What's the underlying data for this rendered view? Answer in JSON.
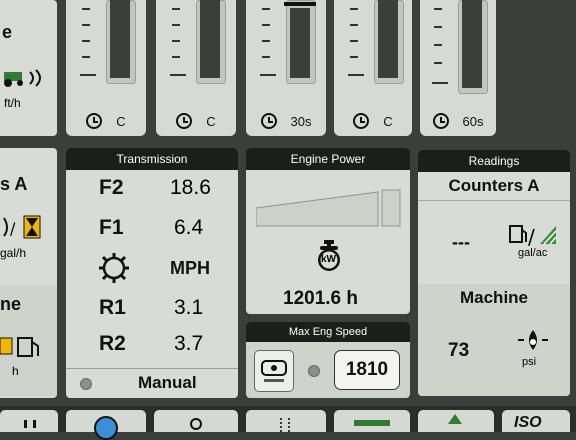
{
  "top_left": {
    "title_fragment": "e",
    "unit": "ft/h"
  },
  "gauges": [
    {
      "label": "C"
    },
    {
      "label": "C"
    },
    {
      "label": "30s"
    },
    {
      "label": "C"
    },
    {
      "label": "60s"
    }
  ],
  "left_panel": {
    "title_fragment": "s A",
    "unit": "gal/h",
    "section2_fragment": "ne",
    "unit2": "h"
  },
  "transmission": {
    "header": "Transmission",
    "rows": [
      {
        "gear": "F2",
        "value": "18.6"
      },
      {
        "gear": "F1",
        "value": "6.4"
      },
      {
        "gear": "",
        "value": "MPH"
      },
      {
        "gear": "R1",
        "value": "3.1"
      },
      {
        "gear": "R2",
        "value": "3.7"
      }
    ],
    "mode": "Manual"
  },
  "engine_power": {
    "header": "Engine Power",
    "hours": "1201.6 h",
    "icon_text": "kW"
  },
  "max_eng_speed": {
    "header": "Max Eng Speed",
    "value": "1810"
  },
  "readings": {
    "header": "Readings",
    "counters_title": "Counters A",
    "counters_value": "---",
    "counters_unit": "gal/ac",
    "machine_title": "Machine",
    "machine_value": "73",
    "machine_unit": "psi"
  },
  "bottom_bar": {
    "iso_label": "ISO"
  }
}
